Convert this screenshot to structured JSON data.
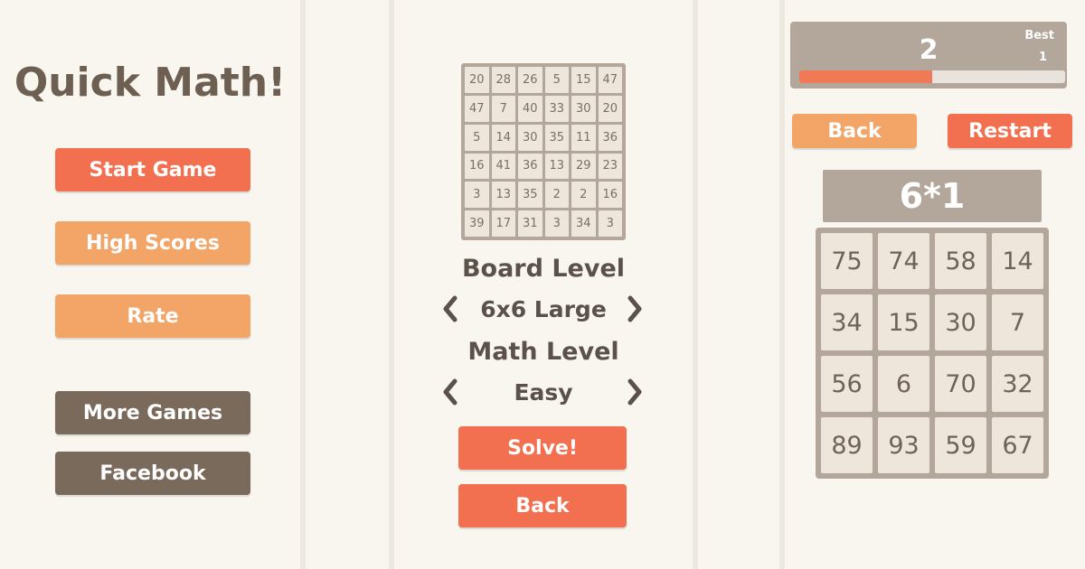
{
  "menu": {
    "title": "Quick Math!",
    "buttons": [
      "Start Game",
      "High Scores",
      "Rate",
      "More Games",
      "Facebook"
    ]
  },
  "settings": {
    "mini_board": [
      [
        "20",
        "28",
        "26",
        "5",
        "15",
        "47"
      ],
      [
        "47",
        "7",
        "40",
        "33",
        "30",
        "20"
      ],
      [
        "5",
        "14",
        "30",
        "35",
        "11",
        "36"
      ],
      [
        "16",
        "41",
        "36",
        "13",
        "29",
        "23"
      ],
      [
        "3",
        "13",
        "35",
        "2",
        "2",
        "16"
      ],
      [
        "39",
        "17",
        "31",
        "3",
        "34",
        "3"
      ]
    ],
    "board_level_label": "Board Level",
    "board_level_value": "6x6 Large",
    "math_level_label": "Math Level",
    "math_level_value": "Easy",
    "solve_label": "Solve!",
    "back_label": "Back"
  },
  "game": {
    "score": "2",
    "best_label": "Best",
    "best_value": "1",
    "progress": 0.5,
    "back_label": "Back",
    "restart_label": "Restart",
    "problem": "6*1",
    "board": [
      [
        "75",
        "74",
        "58",
        "14"
      ],
      [
        "34",
        "15",
        "30",
        "7"
      ],
      [
        "56",
        "6",
        "70",
        "32"
      ],
      [
        "89",
        "93",
        "59",
        "67"
      ]
    ]
  },
  "colors": {
    "primary_orange": "#f26f4f",
    "light_orange": "#f3a467",
    "brown": "#7a6a5c",
    "board_gray": "#b3a79c",
    "tile": "#efe6db",
    "background": "#f8f6ee"
  }
}
